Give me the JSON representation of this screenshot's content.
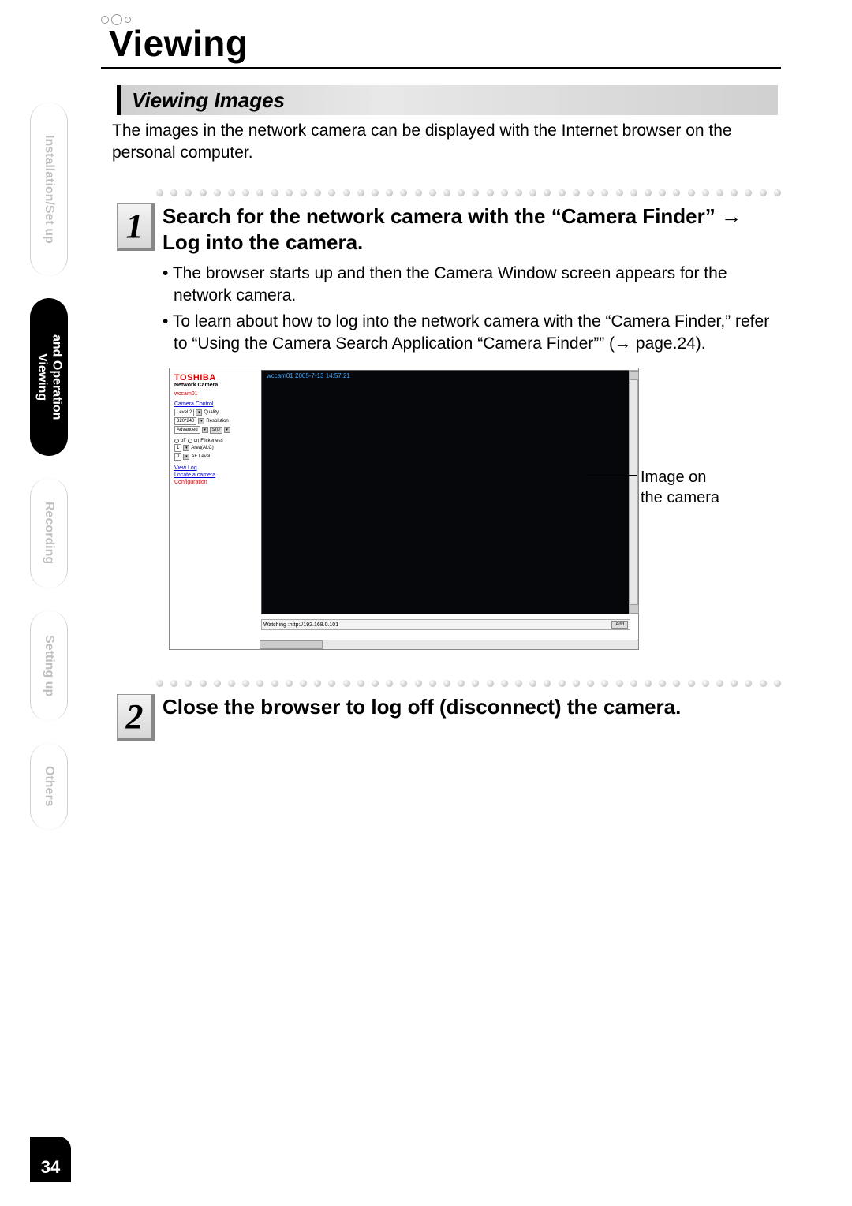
{
  "decoration": {},
  "page_title": "Viewing",
  "section_header": "Viewing Images",
  "intro": "The images in the network camera can be displayed with the Internet browser on the personal computer.",
  "side_tabs": [
    {
      "label": "Installation/Set up",
      "active": false
    },
    {
      "label_line1": "Viewing",
      "label_line2": "and Operation",
      "active": true
    },
    {
      "label": "Recording",
      "active": false
    },
    {
      "label": "Setting up",
      "active": false
    },
    {
      "label": "Others",
      "active": false
    }
  ],
  "steps": {
    "s1": {
      "number": "1",
      "title": "Search for the network camera with the “Camera Finder” → Log into the camera.",
      "bullets": [
        "The browser starts up and then the Camera Window screen appears for the network camera.",
        "To learn about how to log into the network camera with the “Camera Finder,” refer to “Using the Camera Search Application “Camera Finder”” (→ page.24)."
      ]
    },
    "s2": {
      "number": "2",
      "title": "Close the browser to log off (disconnect) the camera."
    }
  },
  "camera_window": {
    "logo": "TOSHIBA",
    "subtitle": "Network Camera",
    "camera_name": "wccam01",
    "camera_control_label": "Camera Control",
    "quality_value": "Level 2",
    "quality_label": "Quality",
    "resolution_value": "320*240",
    "resolution_label": "Resolution",
    "advanced_value": "Advanced",
    "std_btn": "STD",
    "off_label": "off",
    "on_label": "on",
    "flickerless_label": "Flickerless",
    "area_value": "1",
    "area_label": "Area(ALC)",
    "ae_value": "0",
    "ae_label": "AE Level",
    "links": {
      "view_log": "View Log",
      "locate": "Locate a camera",
      "config": "Configuration"
    },
    "video_caption": "wccam01  2005-7-13  14:57:21",
    "status_text": "Watching :http://192.168.0.101",
    "add_btn": "Add"
  },
  "annotation": {
    "line1": "Image on",
    "line2": "the camera"
  },
  "page_number": "34"
}
